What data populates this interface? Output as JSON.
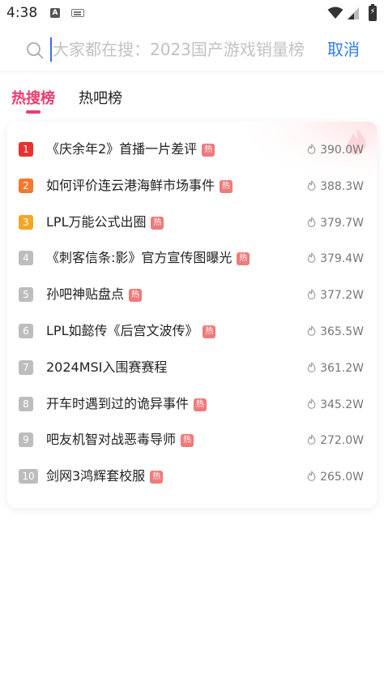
{
  "status_bar": {
    "time": "4:38",
    "a_icon": "A",
    "icons": [
      "notification-a-icon",
      "keyboard-icon",
      "wifi-icon",
      "signal-icon",
      "battery-charging-icon"
    ]
  },
  "search": {
    "placeholder": "大家都在搜：2023国产游戏销量榜",
    "cancel_label": "取消",
    "icon": "search-icon"
  },
  "tabs": [
    {
      "label": "热搜榜",
      "active": true
    },
    {
      "label": "热吧榜",
      "active": false
    }
  ],
  "colors": {
    "accent": "#ee3b6d",
    "link": "#2f7df0",
    "rank_1": "#ec3030",
    "rank_2": "#f5782e",
    "rank_3": "#f5a623",
    "rank_other": "#bdbdbd",
    "hot_badge": "#f07a7a"
  },
  "hot_list": [
    {
      "rank": "1",
      "title": "《庆余年2》首播一片差评",
      "hot": true,
      "hot_label": "热",
      "views": "390.0W"
    },
    {
      "rank": "2",
      "title": "如何评价连云港海鲜市场事件",
      "hot": true,
      "hot_label": "热",
      "views": "388.3W"
    },
    {
      "rank": "3",
      "title": "LPL万能公式出圈",
      "hot": true,
      "hot_label": "热",
      "views": "379.7W"
    },
    {
      "rank": "4",
      "title": "《刺客信条:影》官方宣传图曝光",
      "hot": true,
      "hot_label": "热",
      "views": "379.4W"
    },
    {
      "rank": "5",
      "title": "孙吧神贴盘点",
      "hot": true,
      "hot_label": "热",
      "views": "377.2W"
    },
    {
      "rank": "6",
      "title": "LPL如懿传《后宫文波传》",
      "hot": true,
      "hot_label": "热",
      "views": "365.5W"
    },
    {
      "rank": "7",
      "title": "2024MSI入围赛赛程",
      "hot": false,
      "hot_label": "",
      "views": "361.2W"
    },
    {
      "rank": "8",
      "title": "开车时遇到过的诡异事件",
      "hot": true,
      "hot_label": "热",
      "views": "345.2W"
    },
    {
      "rank": "9",
      "title": "吧友机智对战恶毒导师",
      "hot": true,
      "hot_label": "热",
      "views": "272.0W"
    },
    {
      "rank": "10",
      "title": "剑网3鸿辉套校服",
      "hot": true,
      "hot_label": "热",
      "views": "265.0W"
    }
  ]
}
